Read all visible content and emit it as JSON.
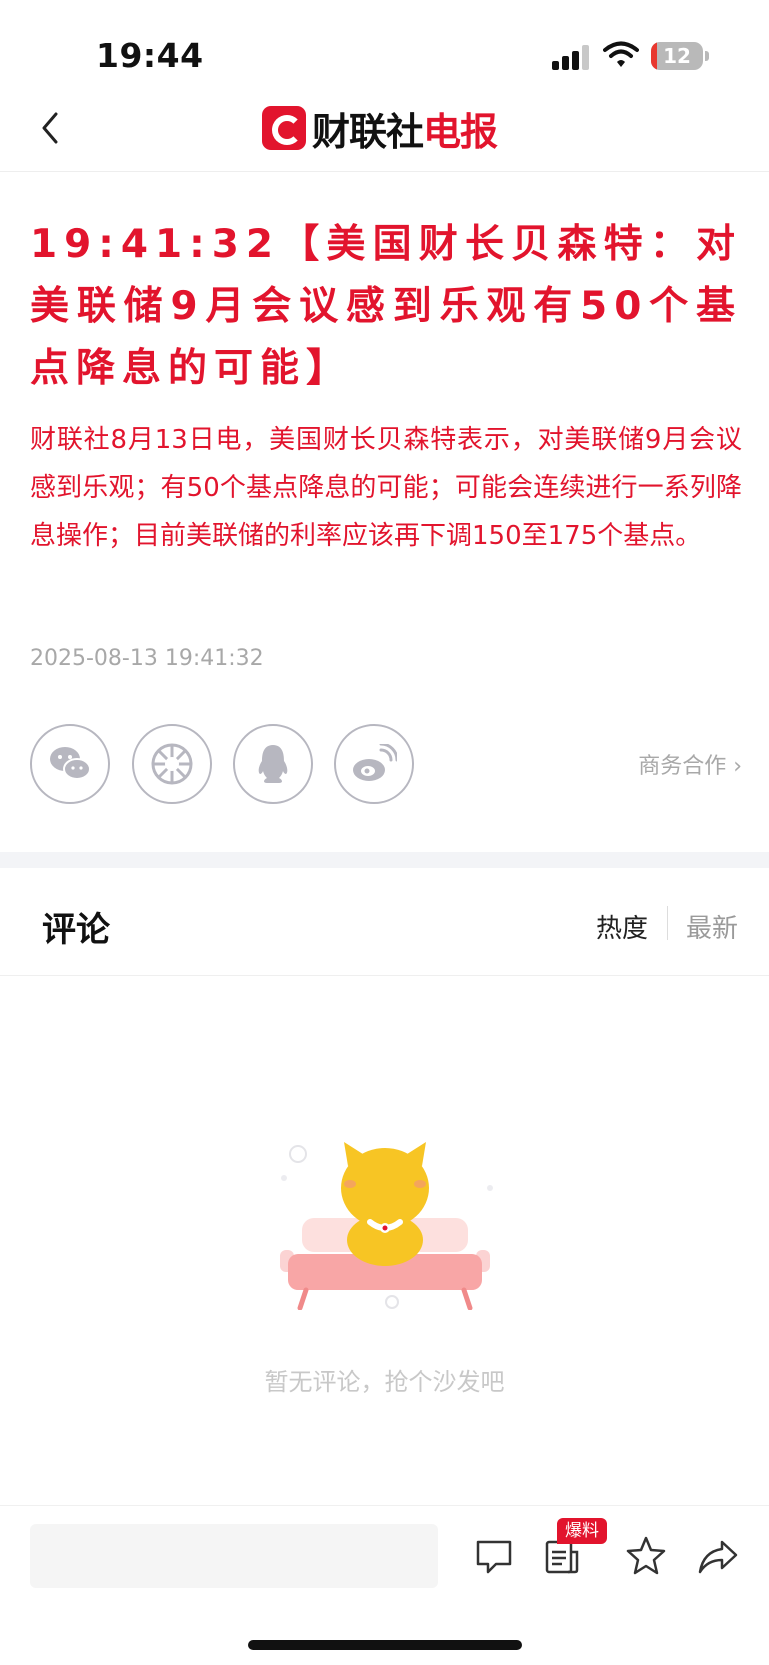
{
  "status_bar": {
    "time": "19:44",
    "battery": "12"
  },
  "nav": {
    "logo_black": "财联社",
    "logo_red": "电报"
  },
  "article": {
    "headline": "19:41:32【美国财长贝森特：对美联储9月会议感到乐观有50个基点降息的可能】",
    "body": "财联社8月13日电，美国财长贝森特表示，对美联储9月会议感到乐观；有50个基点降息的可能；可能会连续进行一系列降息操作；目前美联储的利率应该再下调150至175个基点。",
    "date": "2025-08-13 19:41:32",
    "business_link": "商务合作 ›"
  },
  "share": {
    "icons": [
      "wechat-icon",
      "moments-icon",
      "qq-icon",
      "weibo-icon"
    ]
  },
  "comments": {
    "title": "评论",
    "sort_hot": "热度",
    "sort_new": "最新",
    "empty_text": "暂无评论，抢个沙发吧"
  },
  "bottom_bar": {
    "input_placeholder": "",
    "tip_badge": "爆料"
  },
  "colors": {
    "accent": "#e2142d",
    "muted": "#a8a8a8"
  }
}
